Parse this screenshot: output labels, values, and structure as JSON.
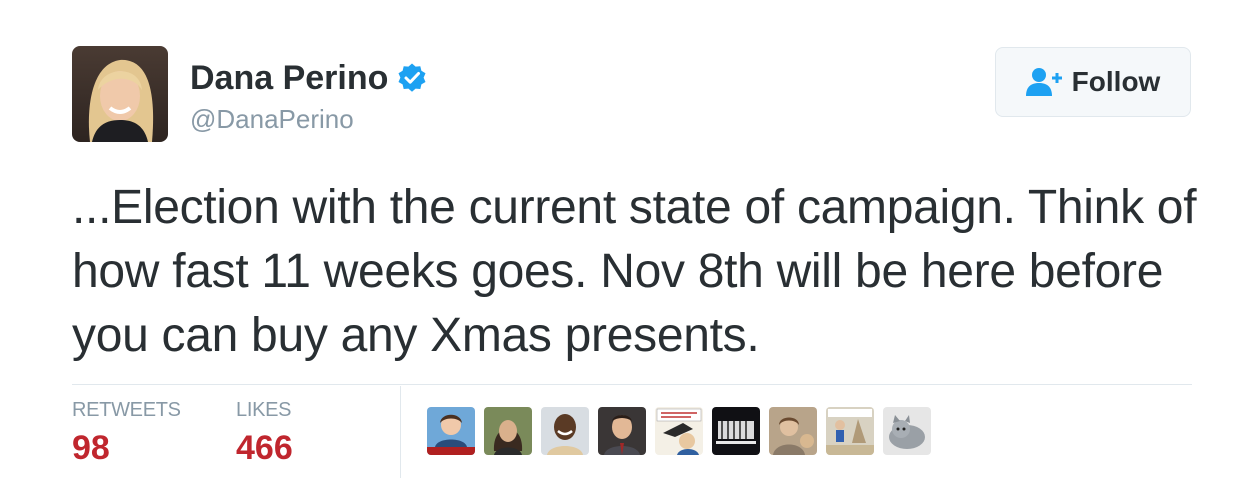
{
  "user": {
    "display_name": "Dana Perino",
    "handle": "@DanaPerino",
    "verified": true,
    "avatar_icon": "profile-photo"
  },
  "follow_button": {
    "label": "Follow",
    "icon": "add-user-icon"
  },
  "tweet": {
    "text": "...Election with the current state of campaign. Think of how fast 11 weeks goes. Nov 8th will be here before you can buy any Xmas presents."
  },
  "stats": {
    "retweets_label": "RETWEETS",
    "retweets_count": "98",
    "likes_label": "LIKES",
    "likes_count": "466"
  },
  "likers": [
    {
      "icon": "liker-avatar-1"
    },
    {
      "icon": "liker-avatar-2"
    },
    {
      "icon": "liker-avatar-3"
    },
    {
      "icon": "liker-avatar-4"
    },
    {
      "icon": "liker-avatar-5"
    },
    {
      "icon": "liker-avatar-6"
    },
    {
      "icon": "liker-avatar-7"
    },
    {
      "icon": "liker-avatar-8"
    },
    {
      "icon": "liker-avatar-9"
    }
  ],
  "colors": {
    "text": "#292f33",
    "muted": "#8899a6",
    "count": "#c0262e",
    "verified": "#1da1f2",
    "follow_icon": "#1da1f2",
    "border": "#e1e8ed"
  }
}
